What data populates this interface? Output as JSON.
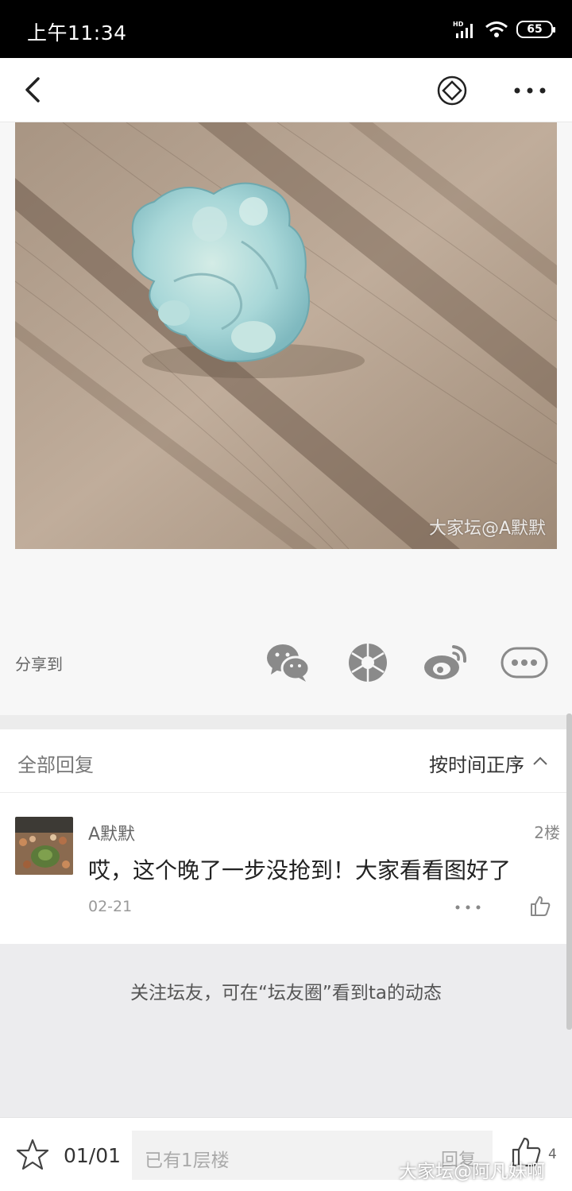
{
  "status_bar": {
    "time": "上午11:34",
    "battery": "65",
    "icons": [
      "hd-signal-icon",
      "wifi-icon",
      "battery-icon"
    ]
  },
  "nav": {
    "icons": [
      "back-icon",
      "diamond-icon",
      "more-icon"
    ]
  },
  "post": {
    "image_watermark": "大家坛@A默默"
  },
  "share": {
    "label": "分享到",
    "icons": [
      "wechat-icon",
      "moments-icon",
      "weibo-icon",
      "more-share-icon"
    ]
  },
  "replies": {
    "header_label": "全部回复",
    "sort_label": "按时间正序"
  },
  "comment": {
    "username": "A默默",
    "floor": "2楼",
    "text": "哎，这个晚了一步没抢到！大家看看图好了",
    "date": "02-21"
  },
  "follow_hint": "关注坛友，可在“坛友圈”看到ta的动态",
  "bottom_bar": {
    "page": "01/01",
    "input_placeholder": "已有1层楼",
    "reply_label": "回复",
    "like_count": "4",
    "watermark": "大家坛@阿凡妹啊"
  },
  "colors": {
    "status_bar_bg": "#000000",
    "page_bg": "#f7f7f7",
    "follow_bg": "#ececee"
  }
}
